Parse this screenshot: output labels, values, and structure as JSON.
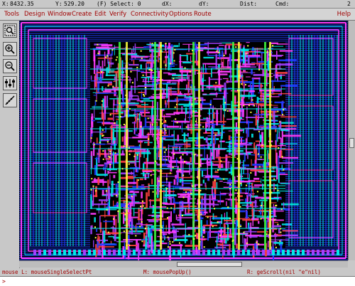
{
  "status": {
    "x_label": "X:",
    "x_value": "8432.35",
    "y_label": "Y:",
    "y_value": "529.20",
    "select": "(F) Select: 0",
    "dx": "dX:",
    "dy": "dY:",
    "dist": "Dist:",
    "cmd": "Cmd:",
    "window_number": "2"
  },
  "menu": {
    "items": [
      "Tools",
      "Design",
      "Window",
      "Create",
      "Edit",
      "Verify",
      "Connectivity",
      "Options",
      "Route"
    ],
    "help": "Help"
  },
  "toolbar": {
    "tools": [
      "zoom-fit-icon",
      "zoom-in-icon",
      "zoom-out-icon",
      "stretch-icon",
      "ruler-icon"
    ]
  },
  "layout_colors": {
    "background": "#000000",
    "metal1": "#1e3cff",
    "metal2": "#ff3cff",
    "metal3": "#00e8e8",
    "metal4": "#a040ff",
    "poly": "#ff4040",
    "via": "#ffff40",
    "boundary": "#40ff40"
  },
  "mouse": {
    "left": "mouse L: mouseSingleSelectPt",
    "middle": "M: mousePopUp()",
    "right": "R: geScroll(nil \"e\"nil)"
  },
  "command": {
    "prompt": ">"
  }
}
